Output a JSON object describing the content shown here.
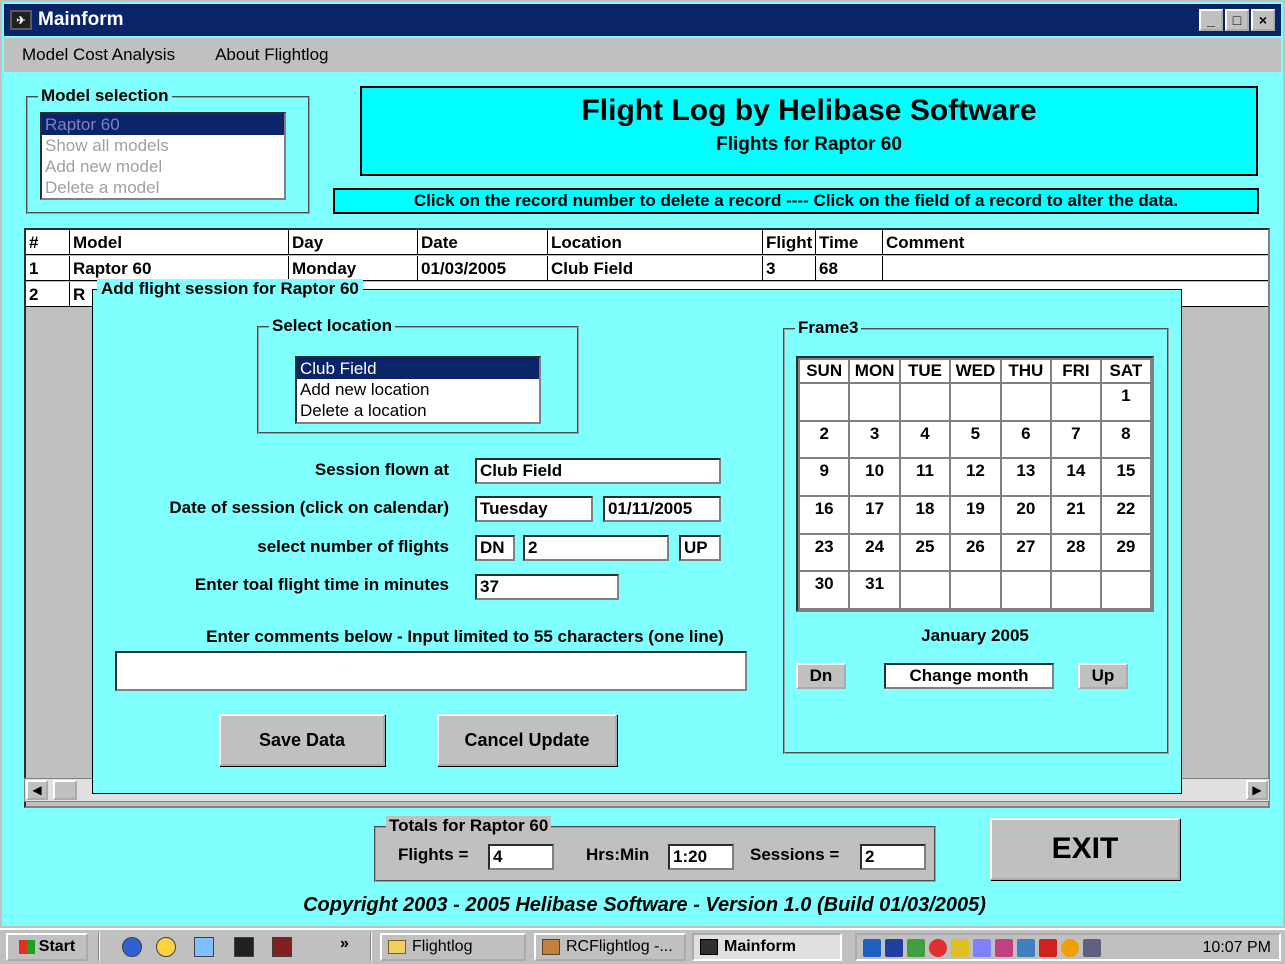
{
  "window": {
    "title": "Mainform",
    "app_icon_glyph": "✈",
    "buttons": [
      "_",
      "□",
      "×"
    ]
  },
  "menu": [
    "Model Cost Analysis",
    "About Flightlog"
  ],
  "model_selection": {
    "legend": "Model selection",
    "items": [
      {
        "label": "Raptor 60",
        "selected": true,
        "disabled": true
      },
      {
        "label": "Show all models",
        "selected": false,
        "disabled": true
      },
      {
        "label": "Add new model",
        "selected": false,
        "disabled": true
      },
      {
        "label": "Delete a model",
        "selected": false,
        "disabled": true
      }
    ]
  },
  "header": {
    "title": "Flight Log by Helibase Software",
    "subtitle": "Flights for Raptor 60",
    "notice": "Click on the record number to delete a record ---- Click on the field of a record to alter the data."
  },
  "grid": {
    "columns": [
      "#",
      "Model",
      "Day",
      "Date",
      "Location",
      "Flight",
      "Time",
      "Comment"
    ],
    "rows": [
      [
        "1",
        "Raptor 60",
        "Monday",
        "01/03/2005",
        "Club Field",
        "3",
        "68",
        ""
      ],
      [
        "2",
        "R",
        "",
        "",
        "",
        "",
        "",
        ""
      ]
    ]
  },
  "dialog": {
    "title": "Add flight session for Raptor 60",
    "location": {
      "legend": "Select location",
      "items": [
        {
          "label": "Club Field",
          "selected": true
        },
        {
          "label": "Add new location",
          "selected": false
        },
        {
          "label": "Delete a location",
          "selected": false
        }
      ]
    },
    "session_flown_label": "Session flown at",
    "session_flown_value": "Club Field",
    "date_label": "Date of session (click on calendar)",
    "day_value": "Tuesday",
    "date_value": "01/11/2005",
    "flights_label": "select number of flights",
    "dn_label": "DN",
    "flights_value": "2",
    "up_label": "UP",
    "time_label": "Enter toal flight time in minutes",
    "time_value": "37",
    "comments_label": "Enter comments below - Input limited to 55 characters (one line)",
    "comments_value": "",
    "save_button": "Save Data",
    "cancel_button": "Cancel Update",
    "calendar": {
      "legend": "Frame3",
      "days": [
        "SUN",
        "MON",
        "TUE",
        "WED",
        "THU",
        "FRI",
        "SAT"
      ],
      "weeks": [
        [
          "",
          "",
          "",
          "",
          "",
          "",
          "1"
        ],
        [
          "2",
          "3",
          "4",
          "5",
          "6",
          "7",
          "8"
        ],
        [
          "9",
          "10",
          "11",
          "12",
          "13",
          "14",
          "15"
        ],
        [
          "16",
          "17",
          "18",
          "19",
          "20",
          "21",
          "22"
        ],
        [
          "23",
          "24",
          "25",
          "26",
          "27",
          "28",
          "29"
        ],
        [
          "30",
          "31",
          "",
          "",
          "",
          "",
          ""
        ]
      ],
      "month_label": "January 2005",
      "dn_button": "Dn",
      "change_month_label": "Change month",
      "up_button": "Up"
    }
  },
  "totals": {
    "legend": "Totals for Raptor 60",
    "flights_label": "Flights =",
    "flights_value": "4",
    "hrsmin_label": "Hrs:Min",
    "hrsmin_value": "1:20",
    "sessions_label": "Sessions =",
    "sessions_value": "2"
  },
  "exit_button": "EXIT",
  "copyright": "Copyright 2003 - 2005  Helibase Software  - Version 1.0 (Build 01/03/2005)",
  "taskbar": {
    "start": "Start",
    "overflow": "»",
    "tasks": [
      {
        "label": "Flightlog",
        "active": false
      },
      {
        "label": "RCFlightlog -...",
        "active": false
      },
      {
        "label": "Mainform",
        "active": true
      }
    ],
    "clock": "10:07 PM"
  }
}
